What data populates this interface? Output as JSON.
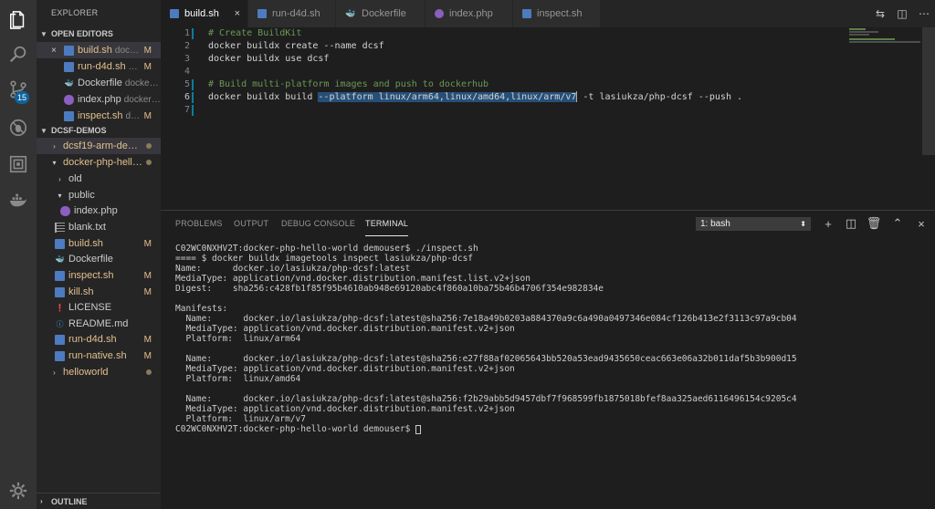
{
  "activity_bar": {
    "scm_badge": "15",
    "icons": [
      "files-icon",
      "search-icon",
      "source-control-icon",
      "debug-icon",
      "extensions-icon",
      "docker-icon",
      "settings-gear-icon"
    ]
  },
  "sidebar": {
    "title": "EXPLORER",
    "open_editors": {
      "header": "OPEN EDITORS",
      "items": [
        {
          "name": "build.sh",
          "desc": "doc…",
          "status": "M",
          "icon": "shell-file-icon",
          "close": "×"
        },
        {
          "name": "run-d4d.sh",
          "desc": "…",
          "status": "M",
          "icon": "shell-file-icon"
        },
        {
          "name": "Dockerfile",
          "desc": "docke…",
          "status": "",
          "icon": "docker-file-icon"
        },
        {
          "name": "index.php",
          "desc": "docker…",
          "status": "",
          "icon": "php-file-icon"
        },
        {
          "name": "inspect.sh",
          "desc": "d…",
          "status": "M",
          "icon": "shell-file-icon"
        }
      ]
    },
    "workspace": {
      "header": "DCSF-DEMOS",
      "items": [
        {
          "name": "dcsf19-arm-de…",
          "type": "folder",
          "collapsed": true
        },
        {
          "name": "docker-php-hell…",
          "type": "folder",
          "collapsed": false
        },
        {
          "name": "old",
          "type": "folder",
          "collapsed": true
        },
        {
          "name": "public",
          "type": "folder",
          "collapsed": false
        },
        {
          "name": "index.php",
          "type": "file",
          "icon": "php-file-icon"
        },
        {
          "name": "blank.txt",
          "type": "file",
          "icon": "text-file-icon"
        },
        {
          "name": "build.sh",
          "type": "file",
          "icon": "shell-file-icon",
          "status": "M"
        },
        {
          "name": "Dockerfile",
          "type": "file",
          "icon": "docker-file-icon"
        },
        {
          "name": "inspect.sh",
          "type": "file",
          "icon": "shell-file-icon",
          "status": "M"
        },
        {
          "name": "kill.sh",
          "type": "file",
          "icon": "shell-file-icon",
          "status": "M"
        },
        {
          "name": "LICENSE",
          "type": "file",
          "icon": "license-file-icon"
        },
        {
          "name": "README.md",
          "type": "file",
          "icon": "markdown-file-icon"
        },
        {
          "name": "run-d4d.sh",
          "type": "file",
          "icon": "shell-file-icon",
          "status": "M"
        },
        {
          "name": "run-native.sh",
          "type": "file",
          "icon": "shell-file-icon",
          "status": "M"
        },
        {
          "name": "helloworld",
          "type": "folder",
          "collapsed": true
        }
      ]
    },
    "outline_header": "OUTLINE"
  },
  "tabs": [
    {
      "label": "build.sh",
      "active": true,
      "icon": "shell-file-icon",
      "close": "×"
    },
    {
      "label": "run-d4d.sh",
      "active": false,
      "icon": "shell-file-icon"
    },
    {
      "label": "Dockerfile",
      "active": false,
      "icon": "docker-file-icon"
    },
    {
      "label": "index.php",
      "active": false,
      "icon": "php-file-icon"
    },
    {
      "label": "inspect.sh",
      "active": false,
      "icon": "shell-file-icon"
    }
  ],
  "editor": {
    "line_numbers": [
      "1",
      "2",
      "3",
      "4",
      "5",
      "6",
      "7"
    ],
    "current_line": "6",
    "lines": [
      "# Create BuildKit",
      "docker buildx create --name dcsf",
      "docker buildx use dcsf",
      "",
      "# Build multi-platform images and push to dockerhub",
      "docker buildx build ",
      ""
    ],
    "line6_selected": "--platform linux/arm64,linux/amd64,linux/arm/v7",
    "line6_rest": " -t lasiukza/php-dcsf --push ."
  },
  "panel": {
    "tabs": [
      "PROBLEMS",
      "OUTPUT",
      "DEBUG CONSOLE",
      "TERMINAL"
    ],
    "active_tab": "TERMINAL",
    "terminal_select": "1: bash",
    "terminal_lines": [
      "C02WC0NXHV2T:docker-php-hello-world demouser$ ./inspect.sh",
      "==== $ docker buildx imagetools inspect lasiukza/php-dcsf",
      "Name:      docker.io/lasiukza/php-dcsf:latest",
      "MediaType: application/vnd.docker.distribution.manifest.list.v2+json",
      "Digest:    sha256:c428fb1f85f95b4610ab948e69120abc4f860a10ba75b46b4706f354e982834e",
      "",
      "Manifests:",
      "  Name:      docker.io/lasiukza/php-dcsf:latest@sha256:7e18a49b0203a884370a9c6a490a0497346e084cf126b413e2f3113c97a9cb04",
      "  MediaType: application/vnd.docker.distribution.manifest.v2+json",
      "  Platform:  linux/arm64",
      "",
      "  Name:      docker.io/lasiukza/php-dcsf:latest@sha256:e27f88af02065643bb520a53ead9435650ceac663e06a32b011daf5b3b900d15",
      "  MediaType: application/vnd.docker.distribution.manifest.v2+json",
      "  Platform:  linux/amd64",
      "",
      "  Name:      docker.io/lasiukza/php-dcsf:latest@sha256:f2b29abb5d9457dbf7f968599fb1875018bfef8aa325aed6116496154c9205c4",
      "  MediaType: application/vnd.docker.distribution.manifest.v2+json",
      "  Platform:  linux/arm/v7",
      "C02WC0NXHV2T:docker-php-hello-world demouser$ "
    ]
  },
  "colors": {
    "accent": "#0e639c",
    "modified": "#e2c08d",
    "comment": "#6a9955",
    "selection": "#264f78"
  }
}
